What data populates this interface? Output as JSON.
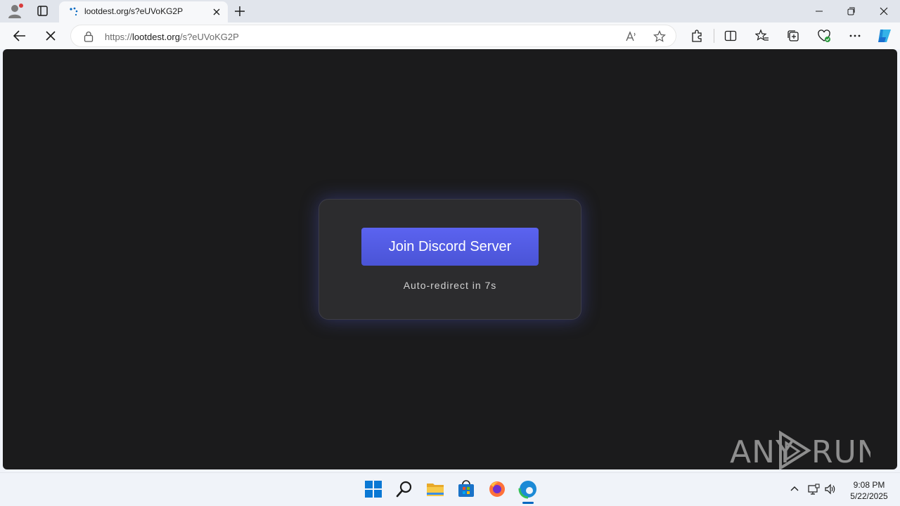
{
  "browser": {
    "tab": {
      "title": "lootdest.org/s?eUVoKG2P"
    },
    "address_bar": {
      "url_scheme": "https://",
      "url_host": "lootdest.org",
      "url_path": "/s?eUVoKG2P"
    }
  },
  "page": {
    "join_button_label": "Join Discord Server",
    "redirect_text": "Auto-redirect in 7s",
    "accent_color": "#5865f2",
    "background_color": "#1b1b1c"
  },
  "watermark": {
    "text_left": "ANY",
    "text_right": "RUN"
  },
  "taskbar": {
    "apps": [
      "windows-start",
      "search",
      "file-explorer",
      "microsoft-store",
      "firefox",
      "edge"
    ],
    "clock": {
      "time": "9:08 PM",
      "date": "5/22/2025"
    }
  }
}
